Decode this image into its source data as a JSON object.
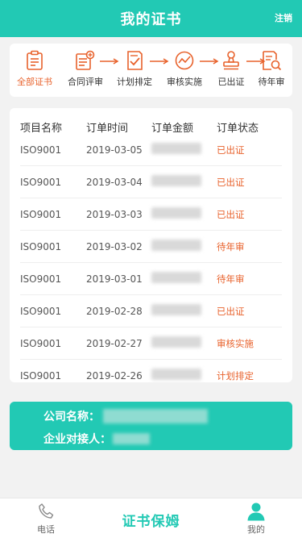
{
  "header": {
    "title": "我的证书",
    "logout": "注销"
  },
  "steps": [
    {
      "label": "全部证书",
      "icon": "clipboard-icon",
      "active": true
    },
    {
      "label": "合同评审",
      "icon": "document-add-icon",
      "active": false
    },
    {
      "label": "计划排定",
      "icon": "document-check-icon",
      "active": false
    },
    {
      "label": "审核实施",
      "icon": "chart-circle-icon",
      "active": false
    },
    {
      "label": "已出证",
      "icon": "stamp-icon",
      "active": false
    },
    {
      "label": "待年审",
      "icon": "document-search-icon",
      "active": false
    }
  ],
  "table": {
    "headers": [
      "项目名称",
      "订单时间",
      "订单金额",
      "订单状态"
    ],
    "rows": [
      {
        "project": "ISO9001",
        "date": "2019-03-05",
        "status": "已出证"
      },
      {
        "project": "ISO9001",
        "date": "2019-03-04",
        "status": "已出证"
      },
      {
        "project": "ISO9001",
        "date": "2019-03-03",
        "status": "已出证"
      },
      {
        "project": "ISO9001",
        "date": "2019-03-02",
        "status": "待年审"
      },
      {
        "project": "ISO9001",
        "date": "2019-03-01",
        "status": "待年审"
      },
      {
        "project": "ISO9001",
        "date": "2019-02-28",
        "status": "已出证"
      },
      {
        "project": "ISO9001",
        "date": "2019-02-27",
        "status": "审核实施"
      },
      {
        "project": "ISO9001",
        "date": "2019-02-26",
        "status": "计划排定"
      }
    ]
  },
  "company": {
    "name_label": "公司名称：",
    "contact_label": "企业对接人："
  },
  "tabbar": {
    "phone": "电话",
    "center": "证书保姆",
    "mine": "我的"
  },
  "colors": {
    "accent": "#22c9b4",
    "orange": "#e8622c"
  }
}
